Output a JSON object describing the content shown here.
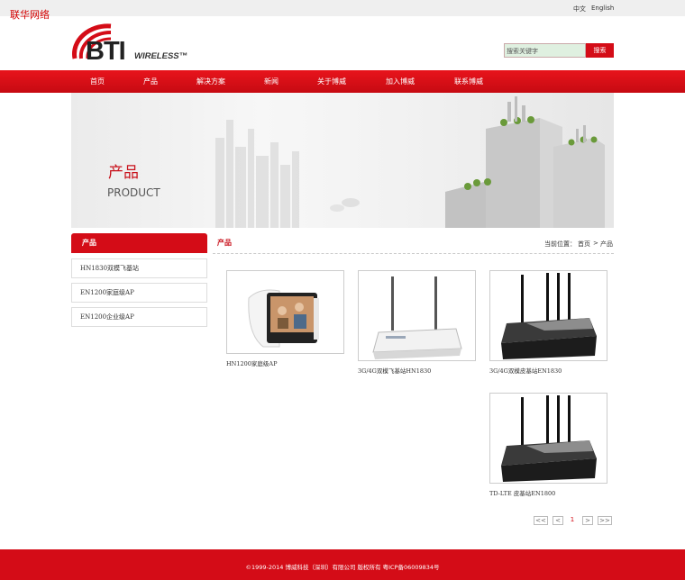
{
  "watermark": "联华网络",
  "header": {
    "lang_zh": "中文",
    "lang_en": "English",
    "logo_text": "BTI",
    "logo_sub": "WIRELESS™"
  },
  "search": {
    "placeholder": "搜索关键字",
    "button": "搜索"
  },
  "nav": {
    "items": [
      "首页",
      "产品",
      "解决方案",
      "新闻",
      "关于博威",
      "加入博威",
      "联系博威"
    ]
  },
  "banner": {
    "title_cn": "产品",
    "title_en": "PRODUCT"
  },
  "sidebar": {
    "heading": "产品",
    "items": [
      "HN1830双模飞基站",
      "EN1200家庭级AP",
      "EN1200企业级AP"
    ]
  },
  "main": {
    "title": "产品",
    "breadcrumb": {
      "prefix": "当前位置：",
      "home": "首页",
      "sep": ">",
      "current": "产品"
    },
    "products": [
      {
        "caption": "HN1200家庭级AP"
      },
      {
        "caption": "3G/4G双模飞基站HN1830"
      },
      {
        "caption": "3G/4G双模皮基站EN1830"
      },
      {
        "caption": "TD-LTE 皮基站EN1800"
      }
    ]
  },
  "pagination": {
    "first": "<<",
    "prev": "<",
    "current": "1",
    "next": ">",
    "last": ">>"
  },
  "footer": {
    "text": "©1999-2014 博威科技（深圳）有限公司 版权所有 粤ICP备06009834号"
  },
  "colors": {
    "brand_red": "#d40c17",
    "search_bg": "#dff0e0"
  }
}
